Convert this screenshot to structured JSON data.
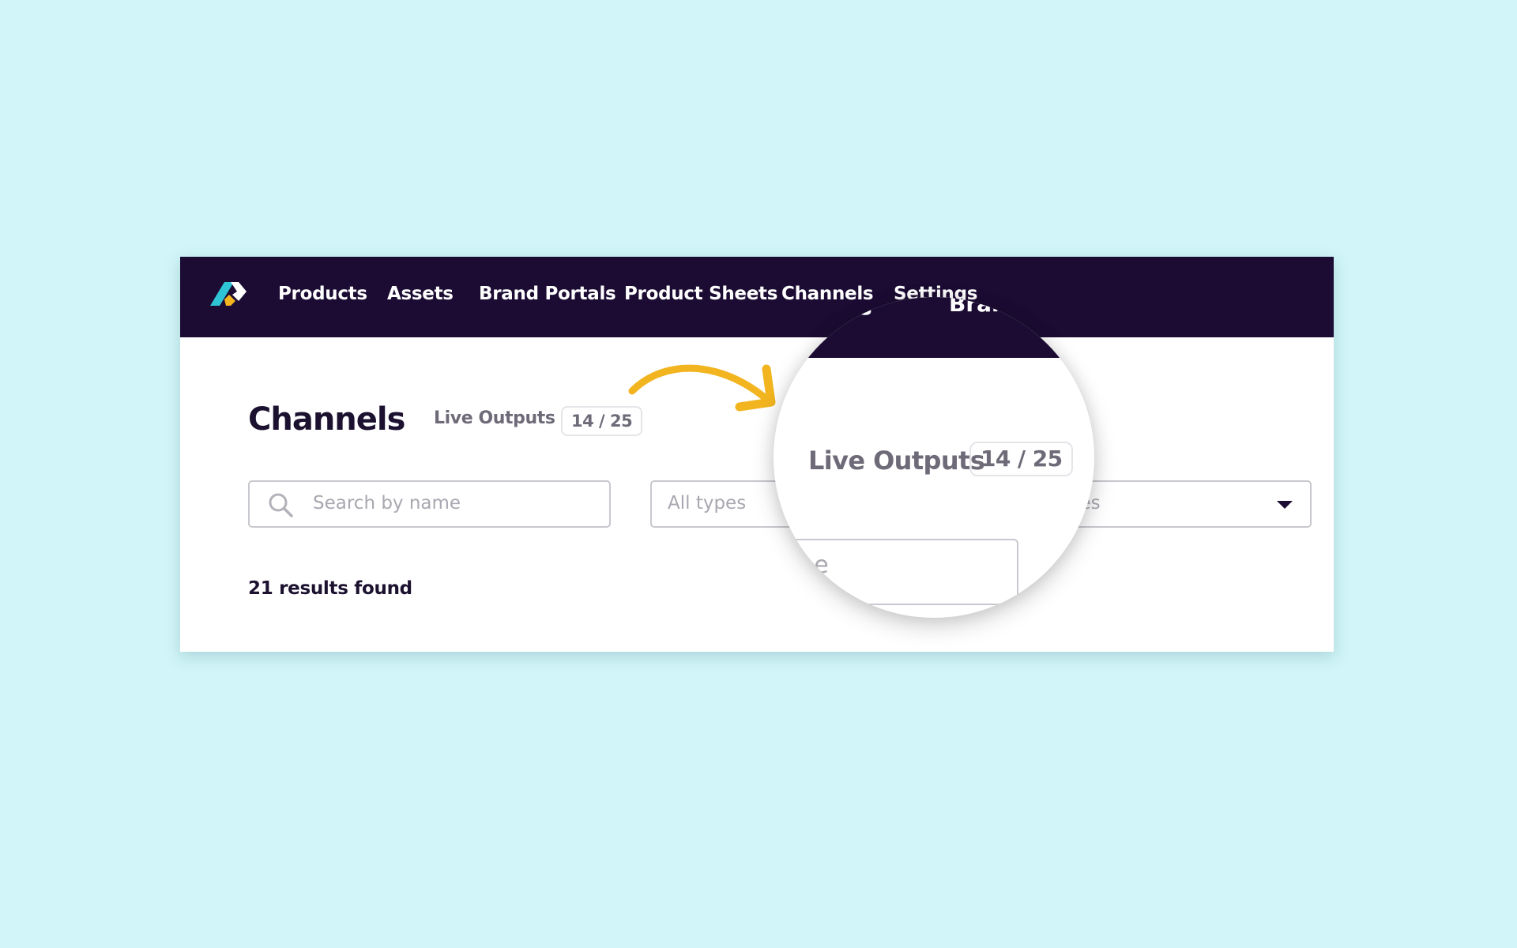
{
  "navbar": {
    "logo": "brand-logo",
    "items": [
      {
        "label": "Products"
      },
      {
        "label": "Assets"
      },
      {
        "label": "Brand Portals"
      },
      {
        "label": "Product Sheets"
      },
      {
        "label": "Channels"
      },
      {
        "label": "Settings"
      }
    ],
    "background": "#1c0c33"
  },
  "page": {
    "title": "Channels",
    "live_outputs_label": "Live Outputs",
    "live_outputs_value": "14 / 25",
    "live_outputs_used": 14,
    "live_outputs_total": 25
  },
  "filters": {
    "search_placeholder": "Search by name",
    "search_icon": "search-icon",
    "type_select_value": "All types",
    "status_select_value": "All statuses",
    "status_select_icon": "caret-down-icon"
  },
  "results": {
    "text": "21 results found",
    "count": 21
  },
  "magnifier": {
    "nav_fragment_left": "s",
    "nav_fragment_right": "Bran",
    "live_outputs_label": "Live Outputs",
    "live_outputs_value": "14 / 25",
    "input_fragment": "me"
  },
  "annotation": {
    "arrow_icon": "curved-arrow-icon",
    "arrow_color": "#f2b520"
  },
  "colors": {
    "background": "#d1f5f8",
    "logo_teal": "#2ec4d6",
    "logo_yellow": "#f2b520",
    "logo_white": "#ffffff"
  }
}
